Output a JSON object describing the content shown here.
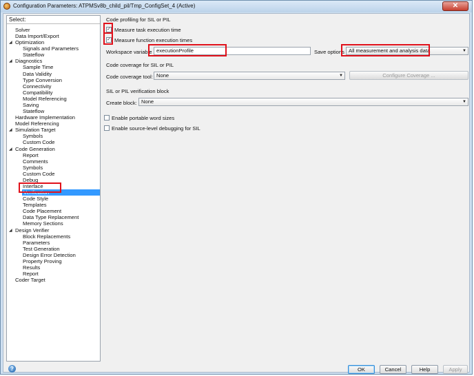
{
  "window": {
    "title": "Configuration Parameters: ATPMSv8b_child_pil/Tmp_ConfigSet_4 (Active)",
    "close_glyph": "✕"
  },
  "tree": {
    "header": "Select:",
    "items": [
      {
        "label": "Solver",
        "level": 0
      },
      {
        "label": "Data Import/Export",
        "level": 0
      },
      {
        "label": "Optimization",
        "level": 0,
        "expanded": true
      },
      {
        "label": "Signals and Parameters",
        "level": 1
      },
      {
        "label": "Stateflow",
        "level": 1
      },
      {
        "label": "Diagnostics",
        "level": 0,
        "expanded": true
      },
      {
        "label": "Sample Time",
        "level": 1
      },
      {
        "label": "Data Validity",
        "level": 1
      },
      {
        "label": "Type Conversion",
        "level": 1
      },
      {
        "label": "Connectivity",
        "level": 1
      },
      {
        "label": "Compatibility",
        "level": 1
      },
      {
        "label": "Model Referencing",
        "level": 1
      },
      {
        "label": "Saving",
        "level": 1
      },
      {
        "label": "Stateflow",
        "level": 1
      },
      {
        "label": "Hardware Implementation",
        "level": 0
      },
      {
        "label": "Model Referencing",
        "level": 0
      },
      {
        "label": "Simulation Target",
        "level": 0,
        "expanded": true
      },
      {
        "label": "Symbols",
        "level": 1
      },
      {
        "label": "Custom Code",
        "level": 1
      },
      {
        "label": "Code Generation",
        "level": 0,
        "expanded": true
      },
      {
        "label": "Report",
        "level": 1
      },
      {
        "label": "Comments",
        "level": 1
      },
      {
        "label": "Symbols",
        "level": 1
      },
      {
        "label": "Custom Code",
        "level": 1
      },
      {
        "label": "Debug",
        "level": 1
      },
      {
        "label": "Interface",
        "level": 1
      },
      {
        "label": "Verification",
        "level": 1,
        "selected": true
      },
      {
        "label": "Code Style",
        "level": 1
      },
      {
        "label": "Templates",
        "level": 1
      },
      {
        "label": "Code Placement",
        "level": 1
      },
      {
        "label": "Data Type Replacement",
        "level": 1
      },
      {
        "label": "Memory Sections",
        "level": 1
      },
      {
        "label": "Design Verifier",
        "level": 0,
        "expanded": true
      },
      {
        "label": "Block Replacements",
        "level": 1
      },
      {
        "label": "Parameters",
        "level": 1
      },
      {
        "label": "Test Generation",
        "level": 1
      },
      {
        "label": "Design Error Detection",
        "level": 1
      },
      {
        "label": "Property Proving",
        "level": 1
      },
      {
        "label": "Results",
        "level": 1
      },
      {
        "label": "Report",
        "level": 1
      },
      {
        "label": "Coder Target",
        "level": 0
      }
    ]
  },
  "profiling": {
    "section_title": "Code profiling for SIL or PIL",
    "measure_task_label": "Measure task execution time",
    "measure_task_checked": true,
    "measure_function_label": "Measure function execution times",
    "measure_function_checked": true,
    "workspace_label": "Workspace variable",
    "workspace_value": "executionProfile",
    "save_options_label": "Save options",
    "save_options_value": "All measurement and analysis data",
    "check_glyph": "✓"
  },
  "coverage": {
    "section_title": "Code coverage for SIL or PIL",
    "tool_label": "Code coverage tool:",
    "tool_value": "None",
    "configure_label": "Configure Coverage ..."
  },
  "verification_block": {
    "section_title": "SIL or PIL verification block",
    "create_label": "Create block:",
    "create_value": "None"
  },
  "options": {
    "portable_label": "Enable portable word sizes",
    "portable_checked": false,
    "source_debug_label": "Enable source-level debugging for SIL",
    "source_debug_checked": false
  },
  "buttons": {
    "ok": "OK",
    "cancel": "Cancel",
    "help": "Help",
    "apply": "Apply"
  },
  "icons": {
    "help": "?",
    "dropdown": "▼",
    "expanded": "◢"
  },
  "colors": {
    "selection": "#3399ff",
    "highlight": "#e0101a"
  }
}
